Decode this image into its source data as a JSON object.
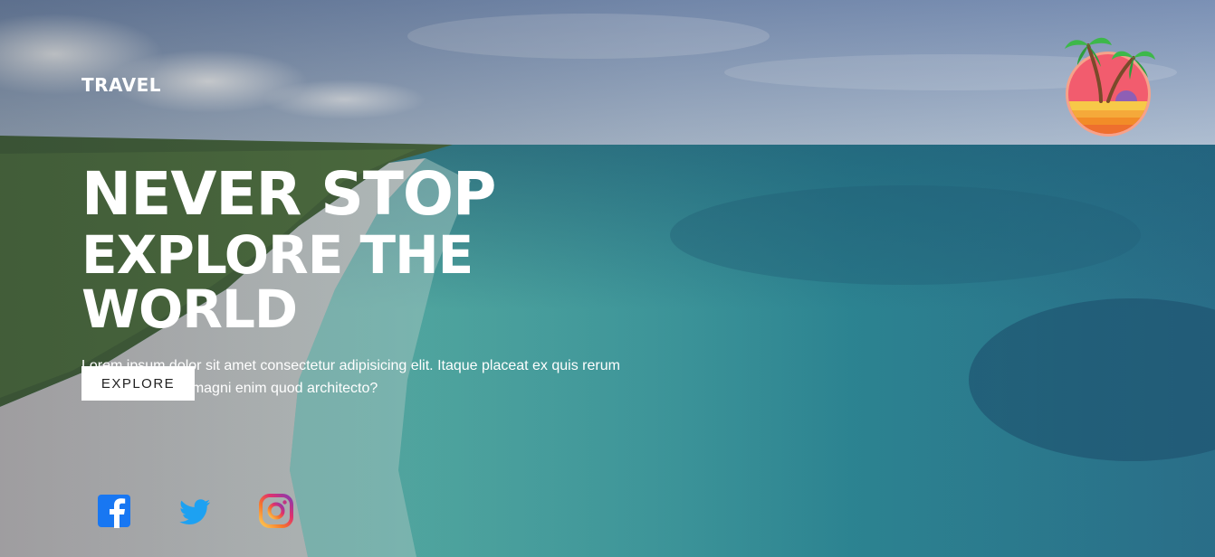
{
  "brand": {
    "name": "TRAVEL"
  },
  "hero": {
    "headline_line1": "NEVER STOP",
    "headline_line2": "EXPLORE THE WORLD",
    "description": "Lorem ipsum dolor sit amet consectetur adipisicing elit. Itaque placeat ex quis rerum fugiat, minima ut magni enim quod architecto?",
    "cta_label": "EXPLORE"
  },
  "social": [
    {
      "icon": "facebook-icon",
      "color": "#1877F2"
    },
    {
      "icon": "twitter-icon",
      "color": "#1DA1F2"
    },
    {
      "icon": "instagram-icon",
      "color": "#E1306C"
    }
  ],
  "logo": {
    "icon": "palm-sunset-icon",
    "colors": [
      "#F25C6E",
      "#F7C948",
      "#F28C28",
      "#3DB84A",
      "#7A4A2A",
      "#8E5FB5"
    ]
  }
}
